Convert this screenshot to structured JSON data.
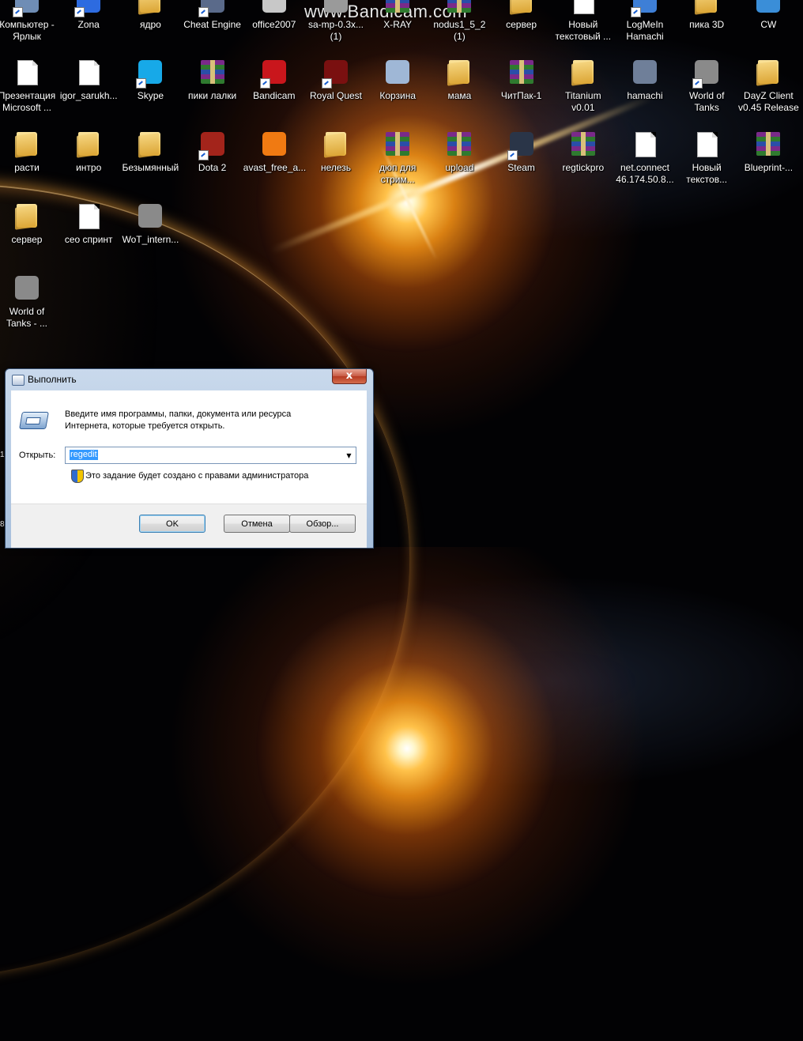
{
  "watermark": "www.Bandicam.com",
  "desktop": {
    "row1": [
      {
        "label": "Компьютер -\nЯрлык",
        "icon": "computer-icon",
        "type": "generic",
        "color": "#6f8db5",
        "shortcut": true
      },
      {
        "label": "Zona",
        "icon": "zona-icon",
        "type": "generic",
        "color": "#2d6be0",
        "shortcut": true
      },
      {
        "label": "ядро",
        "icon": "folder-icon",
        "type": "folder"
      },
      {
        "label": "Cheat Engine",
        "icon": "cheat-engine-icon",
        "type": "generic",
        "color": "#5a6a8a",
        "shortcut": true
      },
      {
        "label": "office2007",
        "icon": "office-icon",
        "type": "generic",
        "color": "#c8c8c8"
      },
      {
        "label": "sa-mp-0.3x...\n(1)",
        "icon": "samp-icon",
        "type": "generic",
        "color": "#9a9a9a"
      },
      {
        "label": "X-RAY",
        "icon": "archive-icon",
        "type": "winrar"
      },
      {
        "label": "nodus1_5_2\n(1)",
        "icon": "archive-icon",
        "type": "winrar"
      },
      {
        "label": "сервер",
        "icon": "folder-icon",
        "type": "folder"
      },
      {
        "label": "Новый\nтекстовый ...",
        "icon": "text-file-icon",
        "type": "doc"
      },
      {
        "label": "LogMeIn\nHamachi",
        "icon": "hamachi-icon",
        "type": "generic",
        "color": "#3e7fd6",
        "shortcut": true
      },
      {
        "label": "пика 3D",
        "icon": "folder-icon",
        "type": "folder"
      },
      {
        "label": "CW",
        "icon": "cw-icon",
        "type": "generic",
        "color": "#3a8ed8"
      }
    ],
    "row2": [
      {
        "label": "Презентация\nMicrosoft ...",
        "icon": "powerpoint-icon",
        "type": "doc"
      },
      {
        "label": "igor_sarukh...",
        "icon": "mp3-file-icon",
        "type": "doc"
      },
      {
        "label": "Skype",
        "icon": "skype-icon",
        "type": "generic",
        "color": "#17a9e8",
        "shortcut": true
      },
      {
        "label": "пики лалки",
        "icon": "archive-icon",
        "type": "winrar"
      },
      {
        "label": "Bandicam",
        "icon": "bandicam-icon",
        "type": "generic",
        "color": "#c9161c",
        "shortcut": true
      },
      {
        "label": "Royal Quest",
        "icon": "royal-quest-icon",
        "type": "generic",
        "color": "#7a1010",
        "shortcut": true
      },
      {
        "label": "Корзина",
        "icon": "recycle-bin-icon",
        "type": "generic",
        "color": "#9fb7d6"
      },
      {
        "label": "мама",
        "icon": "folder-icon",
        "type": "folder"
      },
      {
        "label": "ЧитПак-1",
        "icon": "archive-icon",
        "type": "winrar"
      },
      {
        "label": "Titanium\nv0.01",
        "icon": "folder-icon",
        "type": "folder"
      },
      {
        "label": "hamachi",
        "icon": "installer-icon",
        "type": "generic",
        "color": "#6f7f99"
      },
      {
        "label": "World of\nTanks",
        "icon": "wot-icon",
        "type": "generic",
        "color": "#8a8a8a",
        "shortcut": true
      },
      {
        "label": "DayZ Client\nv0.45 Release",
        "icon": "folder-icon",
        "type": "folder"
      }
    ],
    "row3": [
      {
        "label": "расти",
        "icon": "folder-icon",
        "type": "folder"
      },
      {
        "label": "интро",
        "icon": "folder-icon",
        "type": "folder"
      },
      {
        "label": "Безымянный",
        "icon": "folder-icon",
        "type": "folder"
      },
      {
        "label": "Dota 2",
        "icon": "dota-icon",
        "type": "generic",
        "color": "#a3241b",
        "shortcut": true
      },
      {
        "label": "avast_free_a...",
        "icon": "avast-icon",
        "type": "generic",
        "color": "#f07a12"
      },
      {
        "label": "нелезь",
        "icon": "folder-icon",
        "type": "folder"
      },
      {
        "label": "дюп для\nстрим...",
        "icon": "archive-icon",
        "type": "winrar"
      },
      {
        "label": "upload",
        "icon": "archive-icon",
        "type": "winrar"
      },
      {
        "label": "Steam",
        "icon": "steam-icon",
        "type": "generic",
        "color": "#2a3548",
        "shortcut": true
      },
      {
        "label": "regtickpro",
        "icon": "archive-icon",
        "type": "winrar"
      },
      {
        "label": "net.connect\n46.174.50.8...",
        "icon": "text-file-icon",
        "type": "doc"
      },
      {
        "label": "Новый\nтекстов...",
        "icon": "text-file-icon",
        "type": "doc"
      },
      {
        "label": "Blueprint-...",
        "icon": "archive-icon",
        "type": "winrar"
      }
    ],
    "row4": [
      {
        "label": "сервер",
        "icon": "folder-icon",
        "type": "folder"
      },
      {
        "label": "сео спринт",
        "icon": "text-file-icon",
        "type": "doc"
      },
      {
        "label": "WoT_intern...",
        "icon": "wot-icon",
        "type": "generic",
        "color": "#8a8a8a"
      }
    ],
    "row5": [
      {
        "label": "World of\nTanks - ...",
        "icon": "wot-icon",
        "type": "generic",
        "color": "#8a8a8a"
      }
    ]
  },
  "run_dialog": {
    "title": "Выполнить",
    "close_label": "x",
    "description": "Введите имя программы, папки, документа или ресурса\nИнтернета, которые требуется открыть.",
    "open_label": "Открыть:",
    "open_value": "regedit",
    "admin_note": "Это задание будет создано с правами администратора",
    "ok_label": "OK",
    "cancel_label": "Отмена",
    "browse_label": "Обзор..."
  },
  "edge_marks": {
    "first": "1",
    "second": "8"
  }
}
